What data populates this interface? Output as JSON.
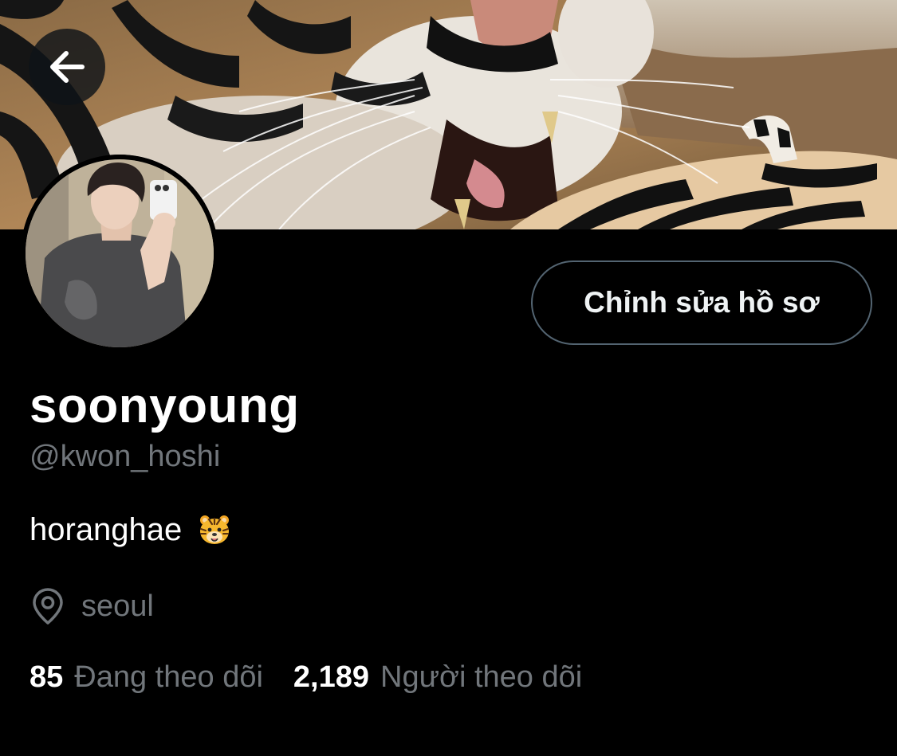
{
  "header": {
    "back_icon": "arrow-left-icon",
    "banner_image": "tiger-banner"
  },
  "profile": {
    "avatar_image": "profile-avatar-photo",
    "edit_button_label": "Chỉnh sửa hồ sơ",
    "display_name": "soonyoung",
    "handle": "@kwon_hoshi",
    "bio_text": "horanghae",
    "bio_emoji": "tiger-face-emoji",
    "location_icon": "location-pin-icon",
    "location": "seoul",
    "following_count": "85",
    "following_label": "Đang theo dõi",
    "followers_count": "2,189",
    "followers_label": "Người theo dõi"
  },
  "colors": {
    "background": "#000000",
    "primary_text": "#ffffff",
    "secondary_text": "#71767b",
    "button_border": "#536471"
  }
}
